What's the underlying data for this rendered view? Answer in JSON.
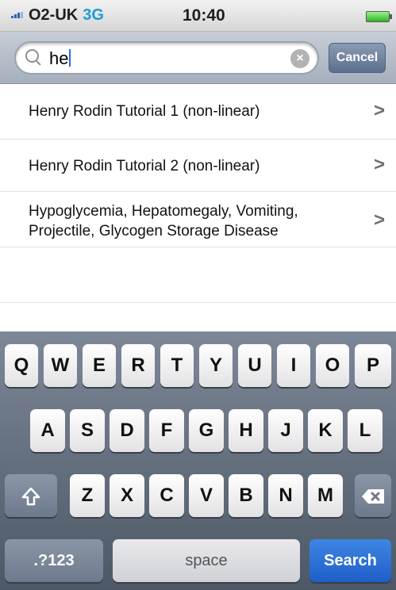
{
  "status_bar": {
    "carrier": "O2-UK",
    "network": "3G",
    "time": "10:40"
  },
  "search": {
    "query": "he",
    "cancel_label": "Cancel"
  },
  "results": [
    {
      "lines": [
        "Henry Rodin Tutorial 1 (non-linear)"
      ]
    },
    {
      "lines": [
        "Henry Rodin Tutorial 2 (non-linear)"
      ]
    },
    {
      "lines": [
        "Hypoglycemia, Hepatomegaly, Vomiting,",
        "Projectile, Glycogen Storage Disease"
      ]
    }
  ],
  "keyboard": {
    "row1": [
      "Q",
      "W",
      "E",
      "R",
      "T",
      "Y",
      "U",
      "I",
      "O",
      "P"
    ],
    "row2": [
      "A",
      "S",
      "D",
      "F",
      "G",
      "H",
      "J",
      "K",
      "L"
    ],
    "row3": [
      "Z",
      "X",
      "C",
      "V",
      "B",
      "N",
      "M"
    ],
    "numbers_label": ".?123",
    "space_label": "space",
    "search_label": "Search"
  },
  "icons": {
    "shift": "shift-icon",
    "backspace": "backspace-icon",
    "search": "search-icon",
    "clear": "clear-icon",
    "chevron": "chevron-right-icon"
  },
  "colors": {
    "search_key": "#2f6fd6",
    "network": "#1e9bd6"
  }
}
